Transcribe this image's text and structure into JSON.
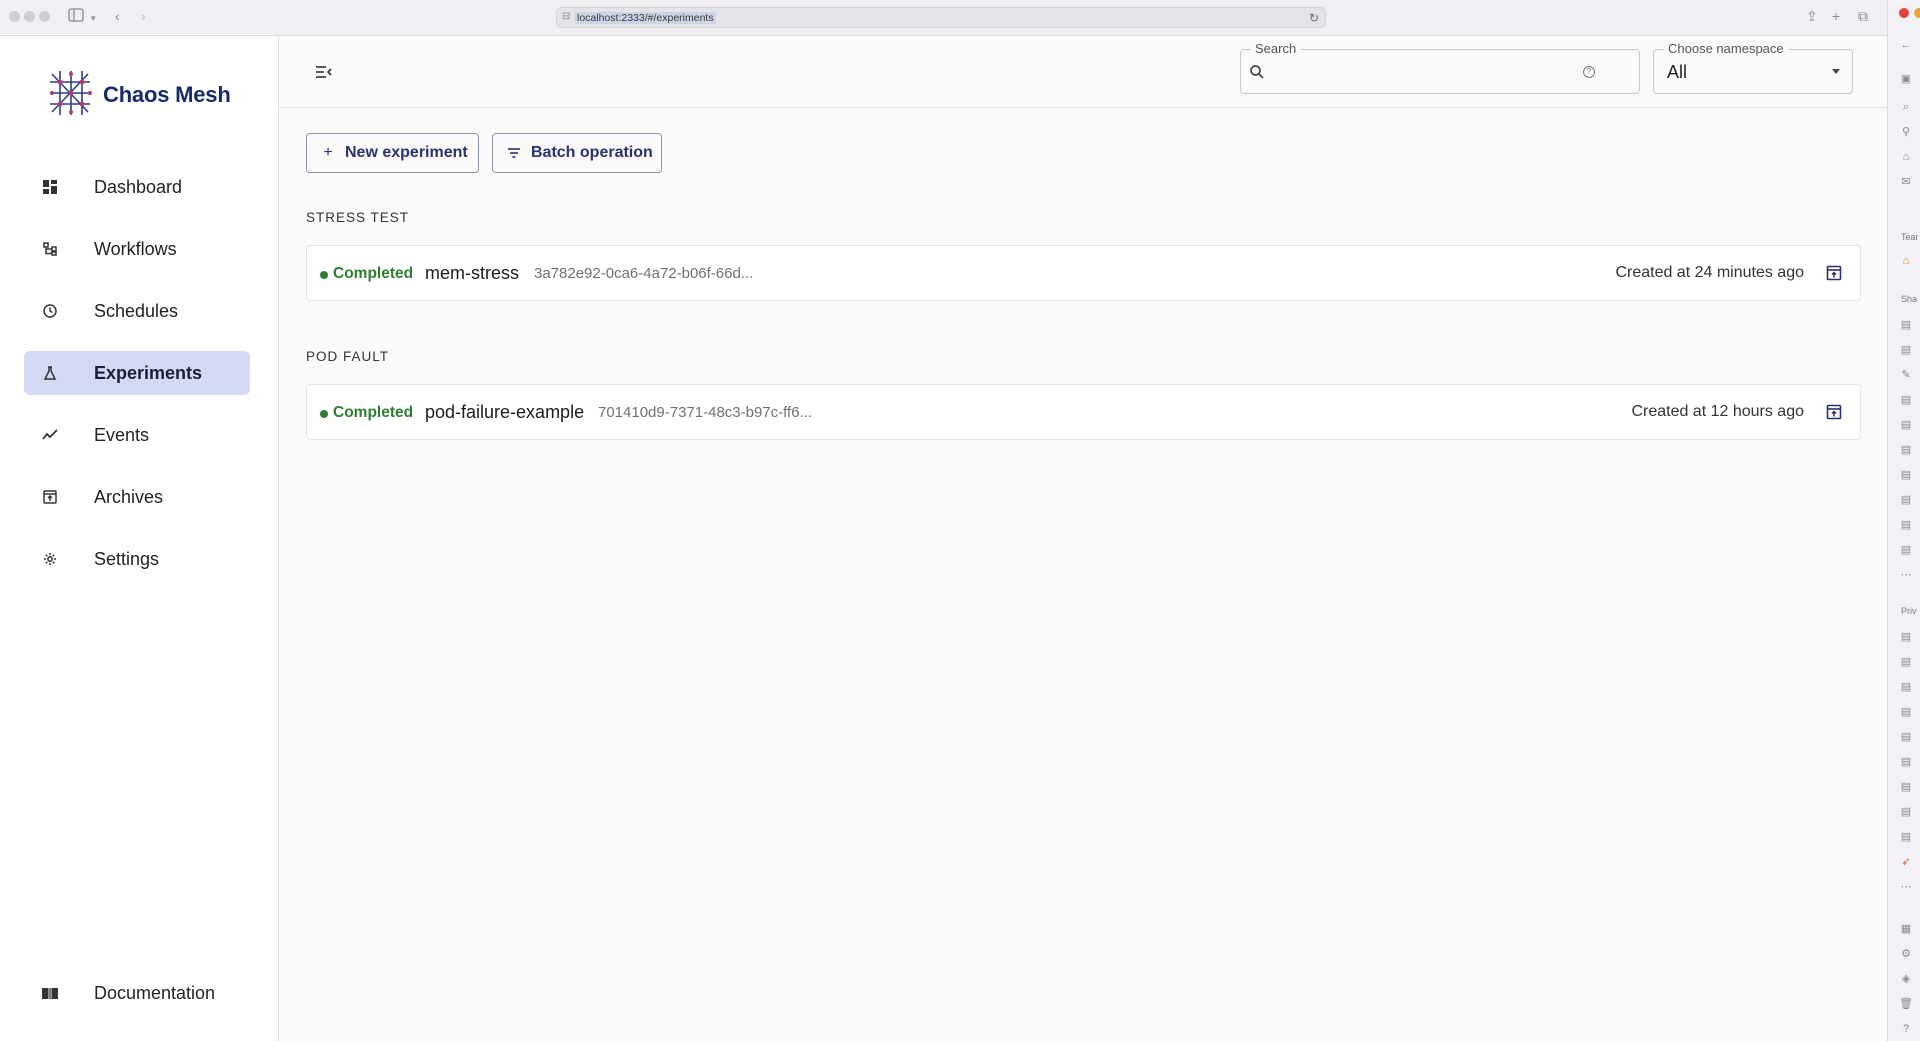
{
  "browser": {
    "url": "localhost:2333/#/experiments"
  },
  "app": {
    "brand": "Chaos Mesh"
  },
  "sidebar": {
    "items": [
      {
        "label": "Dashboard",
        "icon": "dashboard-icon",
        "active": false
      },
      {
        "label": "Workflows",
        "icon": "workflow-icon",
        "active": false
      },
      {
        "label": "Schedules",
        "icon": "clock-icon",
        "active": false
      },
      {
        "label": "Experiments",
        "icon": "flask-icon",
        "active": true
      },
      {
        "label": "Events",
        "icon": "trend-icon",
        "active": false
      },
      {
        "label": "Archives",
        "icon": "archive-icon",
        "active": false
      },
      {
        "label": "Settings",
        "icon": "gear-icon",
        "active": false
      }
    ],
    "documentation": {
      "label": "Documentation",
      "icon": "book-icon"
    }
  },
  "topbar": {
    "search_label": "Search",
    "search_value": "",
    "namespace_label": "Choose namespace",
    "namespace_value": "All"
  },
  "actions": {
    "new_experiment": "New experiment",
    "batch_operation": "Batch operation"
  },
  "groups": [
    {
      "title": "STRESS TEST",
      "experiments": [
        {
          "status": "Completed",
          "name": "mem-stress",
          "uid": "3a782e92-0ca6-4a72-b06f-66d...",
          "created": "Created at 24 minutes ago"
        }
      ]
    },
    {
      "title": "POD FAULT",
      "experiments": [
        {
          "status": "Completed",
          "name": "pod-failure-example",
          "uid": "701410d9-7371-48c3-b97c-ff6...",
          "created": "Created at 12 hours ago"
        }
      ]
    }
  ],
  "colors": {
    "brand": "#172b6b",
    "active_nav": "#d5daf4",
    "status_completed": "#2e7d32",
    "button_text": "#28336e"
  }
}
